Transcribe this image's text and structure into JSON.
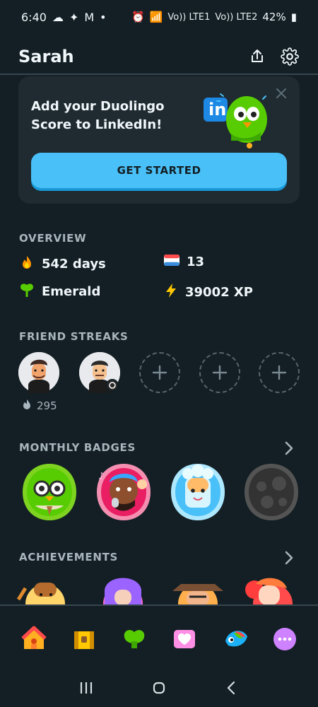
{
  "status": {
    "time": "6:40",
    "left_icons": [
      "cloud-icon",
      "steam-icon",
      "gmail-icon",
      "dot-icon"
    ],
    "right_labels": [
      "Vo)) LTE1",
      "Vo)) LTE2"
    ],
    "battery": "42%"
  },
  "header": {
    "title": "Sarah",
    "share_icon": "share-icon",
    "settings_icon": "gear-icon"
  },
  "promo": {
    "text": "Add your Duolingo Score to LinkedIn!",
    "button": "GET STARTED",
    "logo_text": "in"
  },
  "overview": {
    "title": "OVERVIEW",
    "stats": [
      {
        "icon": "flame-icon",
        "value": "542 days"
      },
      {
        "icon": "flag-icon",
        "value": "13"
      },
      {
        "icon": "emerald-icon",
        "value": "Emerald"
      },
      {
        "icon": "bolt-icon",
        "value": "39002 XP"
      }
    ]
  },
  "friends": {
    "title": "FRIEND STREAKS",
    "count": "295"
  },
  "badges": {
    "title": "MONTHLY BADGES"
  },
  "achievements": {
    "title": "ACHIEVEMENTS"
  },
  "nav": {
    "items": [
      "home-icon",
      "chest-icon",
      "league-icon",
      "heart-icon",
      "character-icon",
      "more-icon"
    ]
  },
  "colors": {
    "background": "#131f24",
    "card": "#1f2b31",
    "accent": "#49c0f8",
    "muted": "#a8b5bd"
  }
}
